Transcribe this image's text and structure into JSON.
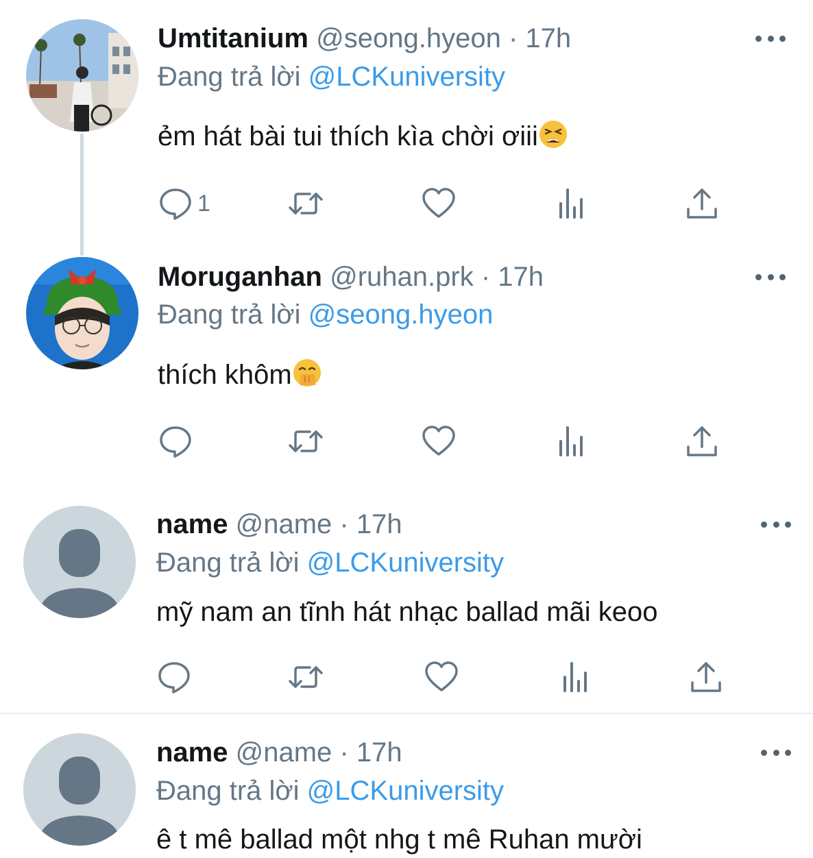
{
  "tweets": [
    {
      "display_name": "Umtitanium",
      "handle": "@seong.hyeon",
      "separator": "·",
      "time": "17h",
      "reply_prefix": "Đang trả lời",
      "reply_to": "@LCKuniversity",
      "text": "ẻm hát bài tui thích kìa chời ơiii",
      "emoji": "tired-face",
      "reply_count": "1",
      "avatar": "photo-person-bicycle-street"
    },
    {
      "display_name": "Moruganhan",
      "handle": "@ruhan.prk",
      "separator": "·",
      "time": "17h",
      "reply_prefix": "Đang trả lời",
      "reply_to": "@seong.hyeon",
      "text": "thích khôm",
      "emoji": "face-with-hand-over-mouth",
      "reply_count": "",
      "avatar": "photo-person-green-hat-glasses"
    },
    {
      "display_name": "name",
      "handle": "@name",
      "separator": "·",
      "time": "17h",
      "reply_prefix": "Đang trả lời",
      "reply_to": "@LCKuniversity",
      "text": "mỹ nam an tĩnh hát nhạc ballad mãi keoo",
      "reply_count": "",
      "avatar": "default-avatar"
    },
    {
      "display_name": "name",
      "handle": "@name",
      "separator": "·",
      "time": "17h",
      "reply_prefix": "Đang trả lời",
      "reply_to": "@LCKuniversity",
      "text": "ê t mê ballad một nhg t mê Ruhan mười",
      "avatar": "default-avatar"
    }
  ],
  "icons": {
    "reply": "speech-bubble-icon",
    "retweet": "retweet-arrows-icon",
    "like": "heart-icon",
    "views": "bar-chart-icon",
    "share": "share-upload-icon",
    "more": "ellipsis-icon"
  },
  "colors": {
    "text": "#14171a",
    "secondary": "#657786",
    "link": "#3b9be8",
    "thread_line": "#cfd9de",
    "default_avatar_bg": "#ccd6dd",
    "default_avatar_fg": "#657786"
  }
}
